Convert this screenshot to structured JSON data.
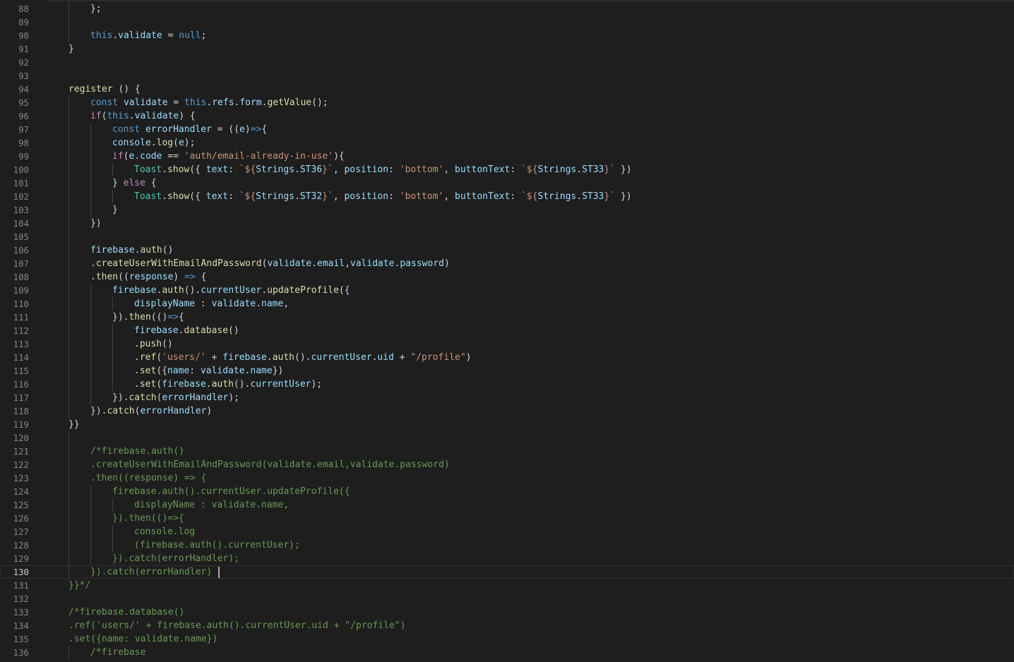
{
  "editor": {
    "current_line": 130,
    "lines": [
      {
        "n": "88",
        "indent": 1,
        "tokens": [
          [
            "};",
            "plain"
          ]
        ]
      },
      {
        "n": "89",
        "indent": 1,
        "tokens": []
      },
      {
        "n": "90",
        "indent": 1,
        "tokens": [
          [
            "this",
            "kw"
          ],
          [
            ".",
            "plain"
          ],
          [
            "validate",
            "var"
          ],
          [
            " = ",
            "op"
          ],
          [
            "null",
            "kw"
          ],
          [
            ";",
            "plain"
          ]
        ]
      },
      {
        "n": "91",
        "indent": 0,
        "tokens": [
          [
            "}",
            "plain"
          ]
        ]
      },
      {
        "n": "92",
        "indent": 0,
        "tokens": []
      },
      {
        "n": "93",
        "indent": 0,
        "tokens": []
      },
      {
        "n": "94",
        "indent": 0,
        "tokens": [
          [
            "register",
            "fn"
          ],
          [
            " () {",
            "plain"
          ]
        ]
      },
      {
        "n": "95",
        "indent": 1,
        "tokens": [
          [
            "const",
            "kw"
          ],
          [
            " ",
            "plain"
          ],
          [
            "validate",
            "var"
          ],
          [
            " = ",
            "op"
          ],
          [
            "this",
            "kw"
          ],
          [
            ".",
            "plain"
          ],
          [
            "refs",
            "var"
          ],
          [
            ".",
            "plain"
          ],
          [
            "form",
            "var"
          ],
          [
            ".",
            "plain"
          ],
          [
            "getValue",
            "fn"
          ],
          [
            "();",
            "plain"
          ]
        ]
      },
      {
        "n": "96",
        "indent": 1,
        "tokens": [
          [
            "if",
            "ctrl"
          ],
          [
            "(",
            "plain"
          ],
          [
            "this",
            "kw"
          ],
          [
            ".",
            "plain"
          ],
          [
            "validate",
            "var"
          ],
          [
            ") {",
            "plain"
          ]
        ]
      },
      {
        "n": "97",
        "indent": 2,
        "tokens": [
          [
            "const",
            "kw"
          ],
          [
            " ",
            "plain"
          ],
          [
            "errorHandler",
            "var"
          ],
          [
            " = ((",
            "plain"
          ],
          [
            "e",
            "param"
          ],
          [
            ")",
            "plain"
          ],
          [
            "=>",
            "kw"
          ],
          [
            "{",
            "plain"
          ]
        ]
      },
      {
        "n": "98",
        "indent": 2,
        "tokens": [
          [
            "console",
            "var"
          ],
          [
            ".",
            "plain"
          ],
          [
            "log",
            "fn"
          ],
          [
            "(",
            "plain"
          ],
          [
            "e",
            "var"
          ],
          [
            ");",
            "plain"
          ]
        ]
      },
      {
        "n": "99",
        "indent": 2,
        "tokens": [
          [
            "if",
            "ctrl"
          ],
          [
            "(",
            "plain"
          ],
          [
            "e",
            "var"
          ],
          [
            ".",
            "plain"
          ],
          [
            "code",
            "var"
          ],
          [
            " == ",
            "op"
          ],
          [
            "'auth/email-already-in-use'",
            "str"
          ],
          [
            "){",
            "plain"
          ]
        ]
      },
      {
        "n": "100",
        "indent": 3,
        "tokens": [
          [
            "Toast",
            "cls"
          ],
          [
            ".",
            "plain"
          ],
          [
            "show",
            "fn"
          ],
          [
            "({ ",
            "plain"
          ],
          [
            "text",
            "prop"
          ],
          [
            ": ",
            "plain"
          ],
          [
            "`${",
            "tpl"
          ],
          [
            "Strings",
            "var"
          ],
          [
            ".",
            "plain"
          ],
          [
            "ST36",
            "var"
          ],
          [
            "}`",
            "tpl"
          ],
          [
            ", ",
            "plain"
          ],
          [
            "position",
            "prop"
          ],
          [
            ": ",
            "plain"
          ],
          [
            "'bottom'",
            "str"
          ],
          [
            ", ",
            "plain"
          ],
          [
            "buttonText",
            "prop"
          ],
          [
            ": ",
            "plain"
          ],
          [
            "`${",
            "tpl"
          ],
          [
            "Strings",
            "var"
          ],
          [
            ".",
            "plain"
          ],
          [
            "ST33",
            "var"
          ],
          [
            "}`",
            "tpl"
          ],
          [
            " })",
            "plain"
          ]
        ]
      },
      {
        "n": "101",
        "indent": 2,
        "tokens": [
          [
            "} ",
            "plain"
          ],
          [
            "else",
            "ctrl"
          ],
          [
            " {",
            "plain"
          ]
        ]
      },
      {
        "n": "102",
        "indent": 3,
        "tokens": [
          [
            "Toast",
            "cls"
          ],
          [
            ".",
            "plain"
          ],
          [
            "show",
            "fn"
          ],
          [
            "({ ",
            "plain"
          ],
          [
            "text",
            "prop"
          ],
          [
            ": ",
            "plain"
          ],
          [
            "`${",
            "tpl"
          ],
          [
            "Strings",
            "var"
          ],
          [
            ".",
            "plain"
          ],
          [
            "ST32",
            "var"
          ],
          [
            "}`",
            "tpl"
          ],
          [
            ", ",
            "plain"
          ],
          [
            "position",
            "prop"
          ],
          [
            ": ",
            "plain"
          ],
          [
            "'bottom'",
            "str"
          ],
          [
            ", ",
            "plain"
          ],
          [
            "buttonText",
            "prop"
          ],
          [
            ": ",
            "plain"
          ],
          [
            "`${",
            "tpl"
          ],
          [
            "Strings",
            "var"
          ],
          [
            ".",
            "plain"
          ],
          [
            "ST33",
            "var"
          ],
          [
            "}`",
            "tpl"
          ],
          [
            " })",
            "plain"
          ]
        ]
      },
      {
        "n": "103",
        "indent": 2,
        "tokens": [
          [
            "}",
            "plain"
          ]
        ]
      },
      {
        "n": "104",
        "indent": 1,
        "tokens": [
          [
            "})",
            "plain"
          ]
        ]
      },
      {
        "n": "105",
        "indent": 1,
        "tokens": []
      },
      {
        "n": "106",
        "indent": 1,
        "tokens": [
          [
            "firebase",
            "var"
          ],
          [
            ".",
            "plain"
          ],
          [
            "auth",
            "fn"
          ],
          [
            "()",
            "plain"
          ]
        ]
      },
      {
        "n": "107",
        "indent": 1,
        "tokens": [
          [
            ".",
            "plain"
          ],
          [
            "createUserWithEmailAndPassword",
            "fn"
          ],
          [
            "(",
            "plain"
          ],
          [
            "validate",
            "var"
          ],
          [
            ".",
            "plain"
          ],
          [
            "email",
            "var"
          ],
          [
            ",",
            "plain"
          ],
          [
            "validate",
            "var"
          ],
          [
            ".",
            "plain"
          ],
          [
            "password",
            "var"
          ],
          [
            ")",
            "plain"
          ]
        ]
      },
      {
        "n": "108",
        "indent": 1,
        "tokens": [
          [
            ".",
            "plain"
          ],
          [
            "then",
            "fn"
          ],
          [
            "((",
            "plain"
          ],
          [
            "response",
            "param"
          ],
          [
            ") ",
            "plain"
          ],
          [
            "=>",
            "kw"
          ],
          [
            " {",
            "plain"
          ]
        ]
      },
      {
        "n": "109",
        "indent": 2,
        "tokens": [
          [
            "firebase",
            "var"
          ],
          [
            ".",
            "plain"
          ],
          [
            "auth",
            "fn"
          ],
          [
            "().",
            "plain"
          ],
          [
            "currentUser",
            "var"
          ],
          [
            ".",
            "plain"
          ],
          [
            "updateProfile",
            "fn"
          ],
          [
            "({",
            "plain"
          ]
        ]
      },
      {
        "n": "110",
        "indent": 3,
        "tokens": [
          [
            "displayName",
            "prop"
          ],
          [
            " : ",
            "plain"
          ],
          [
            "validate",
            "var"
          ],
          [
            ".",
            "plain"
          ],
          [
            "name",
            "var"
          ],
          [
            ",",
            "plain"
          ]
        ]
      },
      {
        "n": "111",
        "indent": 2,
        "tokens": [
          [
            "}).",
            "plain"
          ],
          [
            "then",
            "fn"
          ],
          [
            "(()",
            "plain"
          ],
          [
            "=>",
            "kw"
          ],
          [
            "{",
            "plain"
          ]
        ]
      },
      {
        "n": "112",
        "indent": 3,
        "tokens": [
          [
            "firebase",
            "var"
          ],
          [
            ".",
            "plain"
          ],
          [
            "database",
            "fn"
          ],
          [
            "()",
            "plain"
          ]
        ]
      },
      {
        "n": "113",
        "indent": 3,
        "tokens": [
          [
            ".",
            "plain"
          ],
          [
            "push",
            "fn"
          ],
          [
            "()",
            "plain"
          ]
        ]
      },
      {
        "n": "114",
        "indent": 3,
        "tokens": [
          [
            ".",
            "plain"
          ],
          [
            "ref",
            "fn"
          ],
          [
            "(",
            "plain"
          ],
          [
            "'users/'",
            "str"
          ],
          [
            " + ",
            "op"
          ],
          [
            "firebase",
            "var"
          ],
          [
            ".",
            "plain"
          ],
          [
            "auth",
            "fn"
          ],
          [
            "().",
            "plain"
          ],
          [
            "currentUser",
            "var"
          ],
          [
            ".",
            "plain"
          ],
          [
            "uid",
            "var"
          ],
          [
            " + ",
            "op"
          ],
          [
            "\"/profile\"",
            "str"
          ],
          [
            ")",
            "plain"
          ]
        ]
      },
      {
        "n": "115",
        "indent": 3,
        "tokens": [
          [
            ".",
            "plain"
          ],
          [
            "set",
            "fn"
          ],
          [
            "({",
            "plain"
          ],
          [
            "name",
            "prop"
          ],
          [
            ": ",
            "plain"
          ],
          [
            "validate",
            "var"
          ],
          [
            ".",
            "plain"
          ],
          [
            "name",
            "var"
          ],
          [
            "})",
            "plain"
          ]
        ]
      },
      {
        "n": "116",
        "indent": 3,
        "tokens": [
          [
            ".",
            "plain"
          ],
          [
            "set",
            "fn"
          ],
          [
            "(",
            "plain"
          ],
          [
            "firebase",
            "var"
          ],
          [
            ".",
            "plain"
          ],
          [
            "auth",
            "fn"
          ],
          [
            "().",
            "plain"
          ],
          [
            "currentUser",
            "var"
          ],
          [
            ");",
            "plain"
          ]
        ]
      },
      {
        "n": "117",
        "indent": 2,
        "tokens": [
          [
            "}).",
            "plain"
          ],
          [
            "catch",
            "fn"
          ],
          [
            "(",
            "plain"
          ],
          [
            "errorHandler",
            "var"
          ],
          [
            ");",
            "plain"
          ]
        ]
      },
      {
        "n": "118",
        "indent": 1,
        "tokens": [
          [
            "}).",
            "plain"
          ],
          [
            "catch",
            "fn"
          ],
          [
            "(",
            "plain"
          ],
          [
            "errorHandler",
            "var"
          ],
          [
            ")",
            "plain"
          ]
        ]
      },
      {
        "n": "119",
        "indent": 0,
        "tokens": [
          [
            "}}",
            "plain"
          ]
        ]
      },
      {
        "n": "120",
        "indent": 1,
        "tokens": []
      },
      {
        "n": "121",
        "indent": 1,
        "tokens": [
          [
            "/*firebase.auth()",
            "comment"
          ]
        ]
      },
      {
        "n": "122",
        "indent": 1,
        "tokens": [
          [
            ".createUserWithEmailAndPassword(validate.email,validate.password)",
            "comment"
          ]
        ]
      },
      {
        "n": "123",
        "indent": 1,
        "tokens": [
          [
            ".then((response) => {",
            "comment"
          ]
        ]
      },
      {
        "n": "124",
        "indent": 2,
        "tokens": [
          [
            "firebase.auth().currentUser.updateProfile({",
            "comment"
          ]
        ]
      },
      {
        "n": "125",
        "indent": 3,
        "tokens": [
          [
            "displayName : validate.name,",
            "comment"
          ]
        ]
      },
      {
        "n": "126",
        "indent": 2,
        "tokens": [
          [
            "}).then(()=>{",
            "comment"
          ]
        ]
      },
      {
        "n": "127",
        "indent": 3,
        "tokens": [
          [
            "console.log",
            "comment"
          ]
        ]
      },
      {
        "n": "128",
        "indent": 3,
        "tokens": [
          [
            "(firebase.auth().currentUser);",
            "comment"
          ]
        ]
      },
      {
        "n": "129",
        "indent": 2,
        "tokens": [
          [
            "}).catch(errorHandler);",
            "comment"
          ]
        ]
      },
      {
        "n": "130",
        "indent": 1,
        "tokens": [
          [
            "}).catch(errorHandler) ",
            "comment"
          ]
        ],
        "cursor": true
      },
      {
        "n": "131",
        "indent": 0,
        "tokens": [
          [
            "}}*/",
            "comment"
          ]
        ]
      },
      {
        "n": "132",
        "indent": 0,
        "tokens": []
      },
      {
        "n": "133",
        "indent": 0,
        "tokens": [
          [
            "/*firebase.database()",
            "comment"
          ]
        ]
      },
      {
        "n": "134",
        "indent": 0,
        "tokens": [
          [
            ".ref('users/' + firebase.auth().currentUser.uid + \"/profile\")",
            "comment"
          ]
        ]
      },
      {
        "n": "135",
        "indent": 0,
        "tokens": [
          [
            ".set({name: validate.name})",
            "comment"
          ]
        ]
      },
      {
        "n": "136",
        "indent": 1,
        "tokens": [
          [
            "/*firebase",
            "comment"
          ]
        ]
      }
    ]
  }
}
